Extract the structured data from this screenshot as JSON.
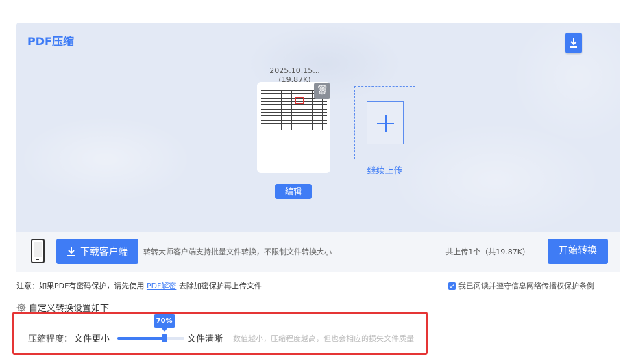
{
  "panel": {
    "title": "PDF压缩"
  },
  "file": {
    "name": "2025.10.15...(19.87K)",
    "edit_label": "编辑"
  },
  "upload": {
    "continue_label": "继续上传"
  },
  "toolbar": {
    "client_button_label": "下载客户端",
    "client_note": "转转大师客户端支持批量文件转换，不限制文件转换大小",
    "upload_count": "共上传1个（共19.87K）",
    "start_button_label": "开始转换"
  },
  "notice": {
    "prefix": "注意：如果PDF有密码保护，请先使用",
    "link": "PDF解密",
    "suffix": "去除加密保护再上传文件",
    "agree_label": "我已阅读并遵守信息网络传播权保护条例",
    "agree_checked": true
  },
  "settings": {
    "heading": "自定义转换设置如下",
    "compress_label": "压缩程度：",
    "smaller_label": "文件更小",
    "clearer_label": "文件清晰",
    "slider_value_label": "70%",
    "slider_value": 70,
    "hint": "数值越小，压缩程度越高，但也会相应的损失文件质量"
  },
  "colors": {
    "accent": "#3f7cf5",
    "highlight": "#e53535"
  }
}
